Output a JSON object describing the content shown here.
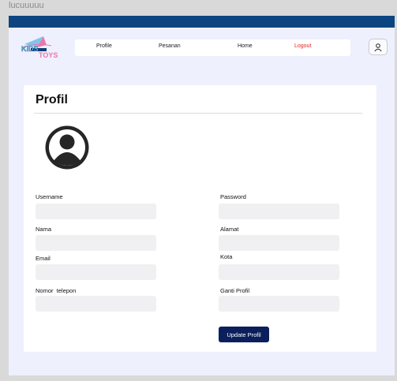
{
  "frame_label": "lucuuuuu",
  "colors": {
    "topbar": "#0d4580",
    "accent": "#0b1f5c",
    "logout": "#e02424",
    "page_bg": "#eef0fd"
  },
  "logo": {
    "line1": "KIDS",
    "line2": "TOYS"
  },
  "nav": {
    "items": [
      "Profile",
      "Pesanan",
      "Home",
      "Logout"
    ]
  },
  "user_button": {
    "icon": "user-icon"
  },
  "profile": {
    "title": "Profil",
    "avatar_icon": "user-circle-icon",
    "fields_left": [
      {
        "label": "Username",
        "value": ""
      },
      {
        "label": "Nama",
        "value": ""
      },
      {
        "label": "Email",
        "value": ""
      },
      {
        "label": "Nomor  telepon",
        "value": ""
      }
    ],
    "fields_right": [
      {
        "label": "Password",
        "value": ""
      },
      {
        "label": "Alamat",
        "value": ""
      },
      {
        "label": "Kota",
        "value": ""
      },
      {
        "label": "Ganti Profil",
        "value": ""
      }
    ],
    "submit_label": "Update Profil"
  }
}
